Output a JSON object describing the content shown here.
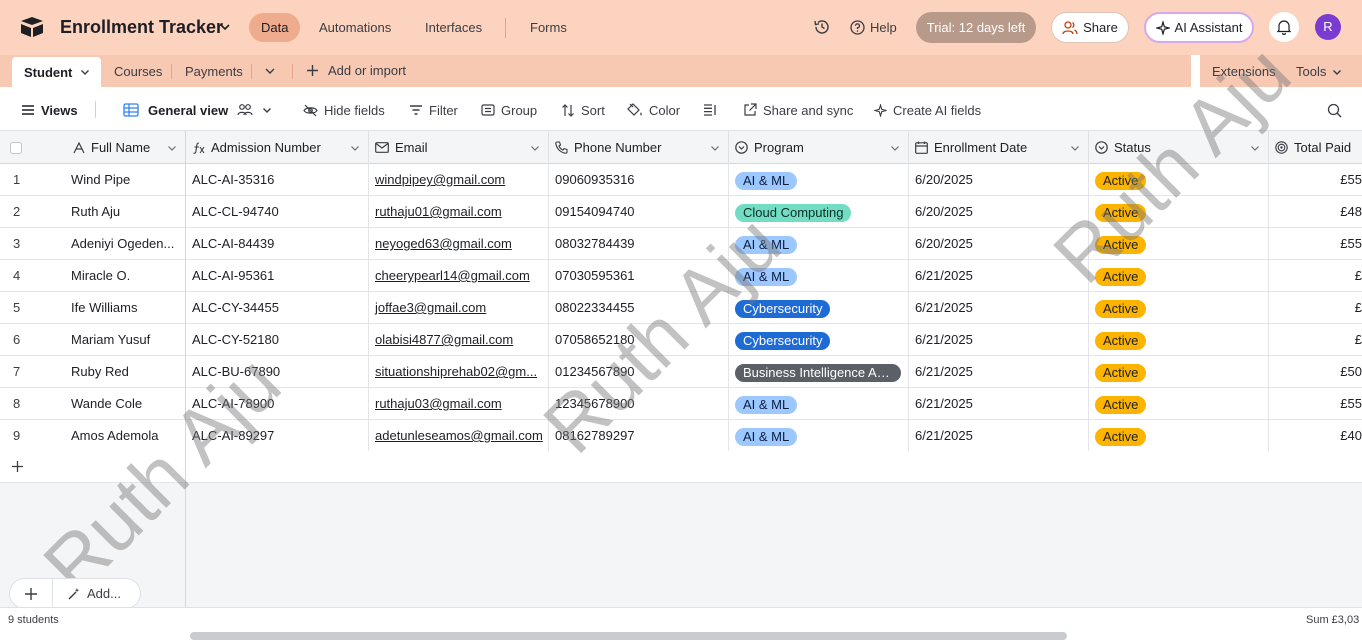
{
  "app": {
    "title": "Enrollment Tracker",
    "nav": [
      "Data",
      "Automations",
      "Interfaces",
      "Forms"
    ],
    "help_label": "Help",
    "trial_label": "Trial: 12 days left",
    "share_label": "Share",
    "ai_label": "AI Assistant",
    "avatar_initial": "R"
  },
  "tabs": {
    "active": "Student",
    "items": [
      "Courses",
      "Payments"
    ],
    "add_label": "Add or import",
    "extensions": "Extensions",
    "tools": "Tools"
  },
  "toolbar": {
    "views": "Views",
    "view_name": "General view",
    "hide_fields": "Hide fields",
    "filter": "Filter",
    "group": "Group",
    "sort": "Sort",
    "color": "Color",
    "share_sync": "Share and sync",
    "create_ai": "Create AI fields"
  },
  "columns": [
    "Full Name",
    "Admission Number",
    "Email",
    "Phone Number",
    "Program",
    "Enrollment Date",
    "Status",
    "Total Paid"
  ],
  "rows": [
    {
      "n": "1",
      "name": "Wind Pipe",
      "adm": "ALC-AI-35316",
      "email": "windpipey@gmail.com",
      "phone": "09060935316",
      "program": "AI & ML",
      "date": "6/20/2025",
      "status": "Active",
      "paid": "£55"
    },
    {
      "n": "2",
      "name": "Ruth Aju",
      "adm": "ALC-CL-94740",
      "email": "ruthaju01@gmail.com",
      "phone": "09154094740",
      "program": "Cloud Computing",
      "date": "6/20/2025",
      "status": "Active",
      "paid": "£48"
    },
    {
      "n": "3",
      "name": "Adeniyi Ogeden...",
      "adm": "ALC-AI-84439",
      "email": "neyoged63@gmail.com",
      "phone": "08032784439",
      "program": "AI & ML",
      "date": "6/20/2025",
      "status": "Active",
      "paid": "£55"
    },
    {
      "n": "4",
      "name": "Miracle O.",
      "adm": "ALC-AI-95361",
      "email": "cheerypearl14@gmail.com",
      "phone": "07030595361",
      "program": "AI & ML",
      "date": "6/21/2025",
      "status": "Active",
      "paid": "£"
    },
    {
      "n": "5",
      "name": "Ife Williams",
      "adm": "ALC-CY-34455",
      "email": "joffae3@gmail.com",
      "phone": "08022334455",
      "program": "Cybersecurity",
      "date": "6/21/2025",
      "status": "Active",
      "paid": "£"
    },
    {
      "n": "6",
      "name": "Mariam Yusuf",
      "adm": "ALC-CY-52180",
      "email": "olabisi4877@gmail.com",
      "phone": "07058652180",
      "program": "Cybersecurity",
      "date": "6/21/2025",
      "status": "Active",
      "paid": "£"
    },
    {
      "n": "7",
      "name": "Ruby Red",
      "adm": "ALC-BU-67890",
      "email": "situationshiprehab02@gm...",
      "phone": "01234567890",
      "program": "Business Intelligence An...",
      "date": "6/21/2025",
      "status": "Active",
      "paid": "£50"
    },
    {
      "n": "8",
      "name": "Wande Cole",
      "adm": "ALC-AI-78900",
      "email": "ruthaju03@gmail.com",
      "phone": "12345678900",
      "program": "AI & ML",
      "date": "6/21/2025",
      "status": "Active",
      "paid": "£55"
    },
    {
      "n": "9",
      "name": "Amos Ademola",
      "adm": "ALC-AI-89297",
      "email": "adetunleseamos@gmail.com",
      "phone": "08162789297",
      "program": "AI & ML",
      "date": "6/21/2025",
      "status": "Active",
      "paid": "£40"
    }
  ],
  "program_colors": {
    "AI & ML": {
      "bg": "#9cc7ff",
      "fg": "#0b1f3d"
    },
    "Cloud Computing": {
      "bg": "#72ddc3",
      "fg": "#0b2e26"
    },
    "Cybersecurity": {
      "bg": "#1f6bd6",
      "fg": "#ffffff"
    },
    "Business Intelligence An...": {
      "bg": "#5b5f66",
      "fg": "#ffffff"
    }
  },
  "status_color": "#fcb400",
  "footer": {
    "count": "9 students",
    "sum": "Sum £3,03"
  },
  "add_more_label": "Add...",
  "watermark": "Ruth Aju"
}
